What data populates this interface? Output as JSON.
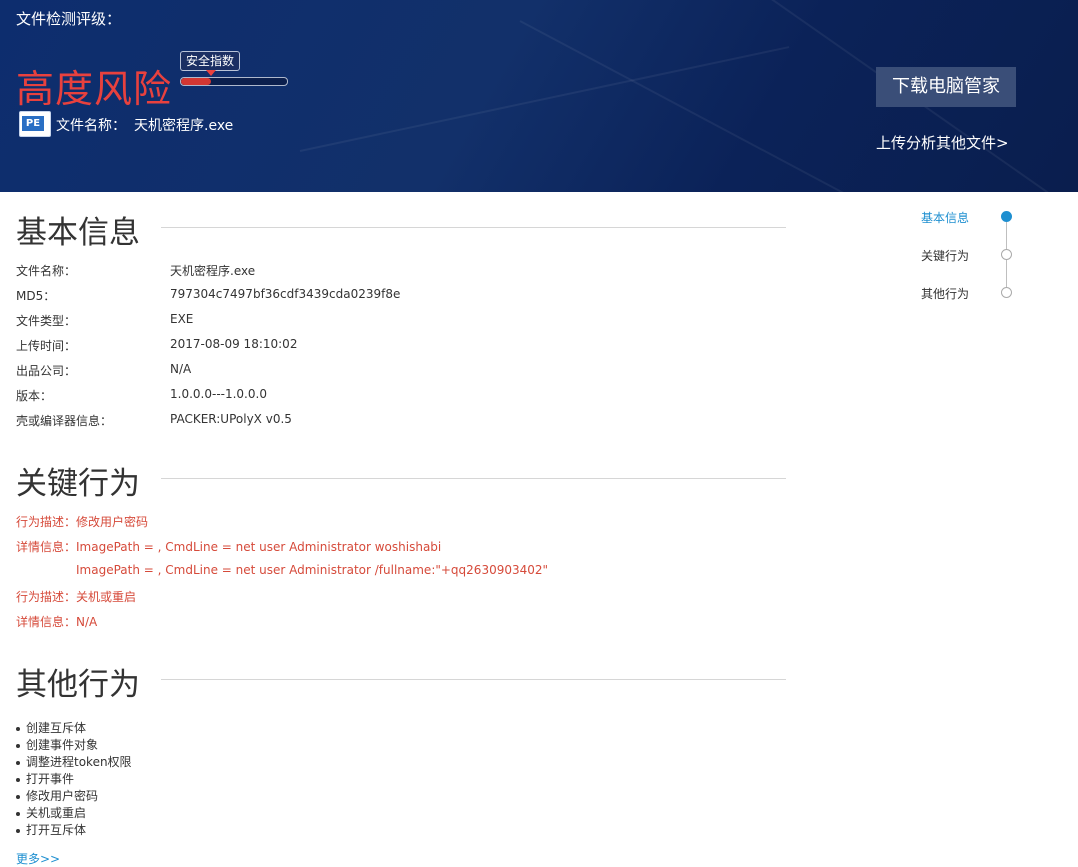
{
  "banner": {
    "rating_label": "文件检测评级：",
    "risk_level": "高度风险",
    "gauge_label": "安全指数",
    "gauge_level": 0.28,
    "file_name_label": "文件名称：",
    "file_name": "天机密程序.exe",
    "file_icon": "PE",
    "download_button": "下载电脑管家",
    "upload_link": "上传分析其他文件>"
  },
  "basic": {
    "title": "基本信息",
    "rows": [
      {
        "label": "文件名称：",
        "value": "天机密程序.exe"
      },
      {
        "label": "MD5：",
        "value": "797304c7497bf36cdf3439cda0239f8e"
      },
      {
        "label": "文件类型：",
        "value": "EXE"
      },
      {
        "label": "上传时间：",
        "value": "2017-08-09 18:10:02"
      },
      {
        "label": "出品公司：",
        "value": "N/A"
      },
      {
        "label": "版本：",
        "value": "1.0.0.0---1.0.0.0"
      },
      {
        "label": "壳或编译器信息：",
        "value": "PACKER:UPolyX v0.5"
      }
    ]
  },
  "key": {
    "title": "关键行为",
    "lines": [
      "行为描述：修改用户密码",
      "详情信息：ImagePath = , CmdLine = net user Administrator woshishabi",
      "ImagePath = , CmdLine = net user Administrator /fullname:\"+qq2630903402\"",
      "行为描述：关机或重启",
      "详情信息：N/A"
    ]
  },
  "other": {
    "title": "其他行为",
    "items": [
      "创建互斥体",
      "创建事件对象",
      "调整进程token权限",
      "打开事件",
      "修改用户密码",
      "关机或重启",
      "打开互斥体"
    ],
    "more_link": "更多>>"
  },
  "nav": {
    "items": [
      "基本信息",
      "关键行为",
      "其他行为"
    ],
    "active": 0
  },
  "colors": {
    "risk": "#e8413e",
    "accent": "#1e8fd0",
    "banner": "#0d2d6e",
    "behavior_text": "#d64a3a"
  }
}
